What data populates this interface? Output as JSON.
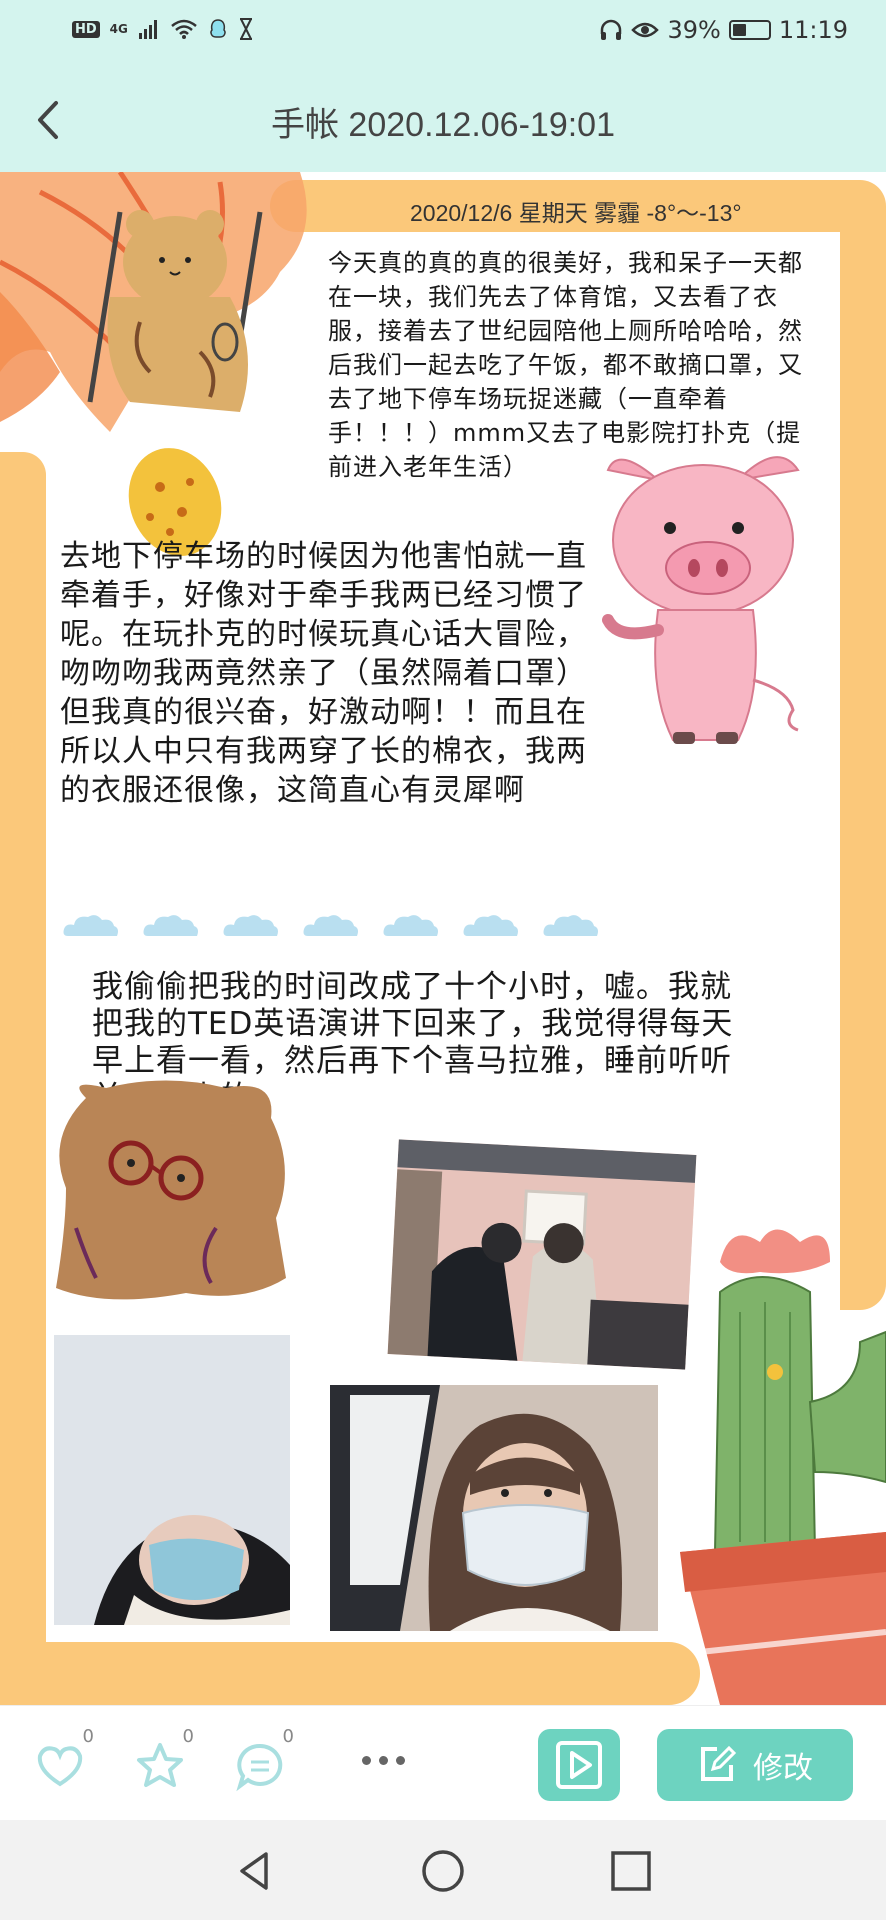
{
  "status_bar": {
    "left": {
      "hd": "HD",
      "network": "4G"
    },
    "right": {
      "battery_percent": "39%",
      "time": "11:19"
    }
  },
  "header": {
    "title": "手帐 2020.12.06-19:01"
  },
  "journal": {
    "date_line": "2020/12/6  星期天  雾霾 -8°～-13°",
    "paragraph1": "今天真的真的真的很美好，我和呆子一天都在一块，我们先去了体育馆，又去看了衣服，接着去了世纪园陪他上厕所哈哈哈，然后我们一起去吃了午饭，都不敢摘口罩，又去了地下停车场玩捉迷藏（一直牵着手！！！）mmm又去了电影院打扑克（提前进入老年生活）",
    "paragraph2": "去地下停车场的时候因为他害怕就一直牵着手，好像对于牵手我两已经习惯了呢。在玩扑克的时候玩真心话大冒险，吻吻吻我两竟然亲了（虽然隔着口罩）但我真的很兴奋，好激动啊！！而且在所以人中只有我两穿了长的棉衣，我两的衣服还很像，这简直心有灵犀啊",
    "paragraph3": "我偷偷把我的时间改成了十个小时，嘘。我就把我的TED英语演讲下回来了，我觉得得每天早上看一看，然后再下个喜马拉雅，睡前听听关于历史的"
  },
  "actions": {
    "like_count": "0",
    "favorite_count": "0",
    "comment_count": "0",
    "edit_label": "修改"
  },
  "colors": {
    "header_bg": "#d4f4ee",
    "accent": "#6dd3c0",
    "frame": "#fbc87a"
  },
  "icons": [
    "back-arrow-icon",
    "heart-icon",
    "star-icon",
    "comment-icon",
    "more-icon",
    "play-icon",
    "edit-icon",
    "nav-back-icon",
    "nav-home-icon",
    "nav-recent-icon"
  ]
}
